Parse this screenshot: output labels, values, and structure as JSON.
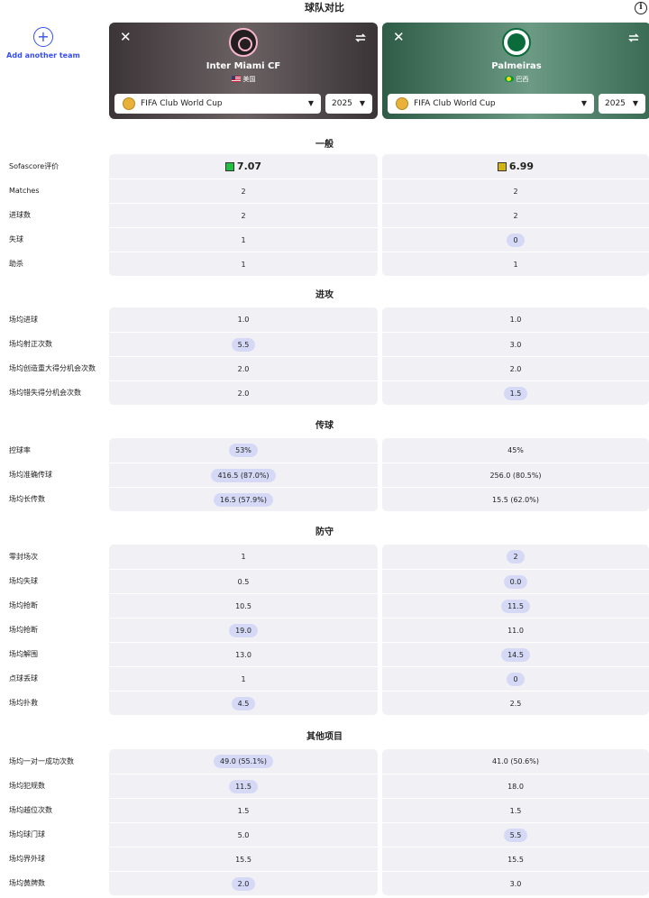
{
  "header": {
    "title": "球队对比",
    "info_icon": "info-icon"
  },
  "add_team": {
    "label": "Add another team",
    "icon": "plus-icon"
  },
  "teams": [
    {
      "name": "Inter Miami CF",
      "country": "美国",
      "competition": "FIFA Club World Cup",
      "season": "2025"
    },
    {
      "name": "Palmeiras",
      "country": "巴西",
      "competition": "FIFA Club World Cup",
      "season": "2025"
    }
  ],
  "colors": {
    "rating_green": "#21c043",
    "rating_yellow": "#d4b312",
    "highlight": "#d5d9f6",
    "accent": "#374df5"
  },
  "sections": [
    {
      "title": "一般",
      "rows": [
        {
          "label": "Sofascore评价",
          "v1": "7.07",
          "v2": "6.99",
          "h1": false,
          "h2": false
        },
        {
          "label": "Matches",
          "v1": "2",
          "v2": "2",
          "h1": false,
          "h2": false
        },
        {
          "label": "进球数",
          "v1": "2",
          "v2": "2",
          "h1": false,
          "h2": false
        },
        {
          "label": "失球",
          "v1": "1",
          "v2": "0",
          "h1": false,
          "h2": true
        },
        {
          "label": "助杀",
          "v1": "1",
          "v2": "1",
          "h1": false,
          "h2": false
        }
      ]
    },
    {
      "title": "进攻",
      "rows": [
        {
          "label": "场均进球",
          "v1": "1.0",
          "v2": "1.0",
          "h1": false,
          "h2": false
        },
        {
          "label": "场均射正次数",
          "v1": "5.5",
          "v2": "3.0",
          "h1": true,
          "h2": false
        },
        {
          "label": "场均创造重大得分机会次数",
          "v1": "2.0",
          "v2": "2.0",
          "h1": false,
          "h2": false
        },
        {
          "label": "场均错失得分机会次数",
          "v1": "2.0",
          "v2": "1.5",
          "h1": false,
          "h2": true
        }
      ]
    },
    {
      "title": "传球",
      "rows": [
        {
          "label": "控球率",
          "v1": "53%",
          "v2": "45%",
          "h1": true,
          "h2": false
        },
        {
          "label": "场均准确传球",
          "v1": "416.5 (87.0%)",
          "v2": "256.0 (80.5%)",
          "h1": true,
          "h2": false
        },
        {
          "label": "场均长传数",
          "v1": "16.5 (57.9%)",
          "v2": "15.5 (62.0%)",
          "h1": true,
          "h2": false
        }
      ]
    },
    {
      "title": "防守",
      "rows": [
        {
          "label": "零封场次",
          "v1": "1",
          "v2": "2",
          "h1": false,
          "h2": true
        },
        {
          "label": "场均失球",
          "v1": "0.5",
          "v2": "0.0",
          "h1": false,
          "h2": true
        },
        {
          "label": "场均抢断",
          "v1": "10.5",
          "v2": "11.5",
          "h1": false,
          "h2": true
        },
        {
          "label": "场均抢断",
          "v1": "19.0",
          "v2": "11.0",
          "h1": true,
          "h2": false
        },
        {
          "label": "场均解围",
          "v1": "13.0",
          "v2": "14.5",
          "h1": false,
          "h2": true
        },
        {
          "label": "点球丢球",
          "v1": "1",
          "v2": "0",
          "h1": false,
          "h2": true
        },
        {
          "label": "场均扑救",
          "v1": "4.5",
          "v2": "2.5",
          "h1": true,
          "h2": false
        }
      ]
    },
    {
      "title": "其他项目",
      "rows": [
        {
          "label": "场均一对一成功次数",
          "v1": "49.0 (55.1%)",
          "v2": "41.0 (50.6%)",
          "h1": true,
          "h2": false
        },
        {
          "label": "场均犯规数",
          "v1": "11.5",
          "v2": "18.0",
          "h1": true,
          "h2": false
        },
        {
          "label": "场均越位次数",
          "v1": "1.5",
          "v2": "1.5",
          "h1": false,
          "h2": false
        },
        {
          "label": "场均球门球",
          "v1": "5.0",
          "v2": "5.5",
          "h1": false,
          "h2": true
        },
        {
          "label": "场均界外球",
          "v1": "15.5",
          "v2": "15.5",
          "h1": false,
          "h2": false
        },
        {
          "label": "场均黄牌数",
          "v1": "2.0",
          "v2": "3.0",
          "h1": true,
          "h2": false
        }
      ]
    }
  ]
}
